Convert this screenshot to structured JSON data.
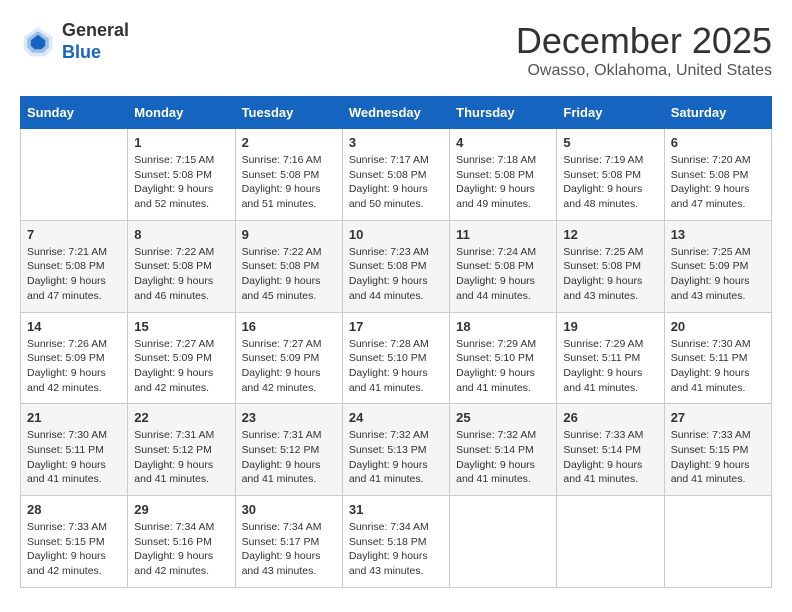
{
  "logo": {
    "general": "General",
    "blue": "Blue"
  },
  "header": {
    "month": "December 2025",
    "location": "Owasso, Oklahoma, United States"
  },
  "weekdays": [
    "Sunday",
    "Monday",
    "Tuesday",
    "Wednesday",
    "Thursday",
    "Friday",
    "Saturday"
  ],
  "weeks": [
    [
      {
        "day": "",
        "info": ""
      },
      {
        "day": "1",
        "info": "Sunrise: 7:15 AM\nSunset: 5:08 PM\nDaylight: 9 hours\nand 52 minutes."
      },
      {
        "day": "2",
        "info": "Sunrise: 7:16 AM\nSunset: 5:08 PM\nDaylight: 9 hours\nand 51 minutes."
      },
      {
        "day": "3",
        "info": "Sunrise: 7:17 AM\nSunset: 5:08 PM\nDaylight: 9 hours\nand 50 minutes."
      },
      {
        "day": "4",
        "info": "Sunrise: 7:18 AM\nSunset: 5:08 PM\nDaylight: 9 hours\nand 49 minutes."
      },
      {
        "day": "5",
        "info": "Sunrise: 7:19 AM\nSunset: 5:08 PM\nDaylight: 9 hours\nand 48 minutes."
      },
      {
        "day": "6",
        "info": "Sunrise: 7:20 AM\nSunset: 5:08 PM\nDaylight: 9 hours\nand 47 minutes."
      }
    ],
    [
      {
        "day": "7",
        "info": "Sunrise: 7:21 AM\nSunset: 5:08 PM\nDaylight: 9 hours\nand 47 minutes."
      },
      {
        "day": "8",
        "info": "Sunrise: 7:22 AM\nSunset: 5:08 PM\nDaylight: 9 hours\nand 46 minutes."
      },
      {
        "day": "9",
        "info": "Sunrise: 7:22 AM\nSunset: 5:08 PM\nDaylight: 9 hours\nand 45 minutes."
      },
      {
        "day": "10",
        "info": "Sunrise: 7:23 AM\nSunset: 5:08 PM\nDaylight: 9 hours\nand 44 minutes."
      },
      {
        "day": "11",
        "info": "Sunrise: 7:24 AM\nSunset: 5:08 PM\nDaylight: 9 hours\nand 44 minutes."
      },
      {
        "day": "12",
        "info": "Sunrise: 7:25 AM\nSunset: 5:08 PM\nDaylight: 9 hours\nand 43 minutes."
      },
      {
        "day": "13",
        "info": "Sunrise: 7:25 AM\nSunset: 5:09 PM\nDaylight: 9 hours\nand 43 minutes."
      }
    ],
    [
      {
        "day": "14",
        "info": "Sunrise: 7:26 AM\nSunset: 5:09 PM\nDaylight: 9 hours\nand 42 minutes."
      },
      {
        "day": "15",
        "info": "Sunrise: 7:27 AM\nSunset: 5:09 PM\nDaylight: 9 hours\nand 42 minutes."
      },
      {
        "day": "16",
        "info": "Sunrise: 7:27 AM\nSunset: 5:09 PM\nDaylight: 9 hours\nand 42 minutes."
      },
      {
        "day": "17",
        "info": "Sunrise: 7:28 AM\nSunset: 5:10 PM\nDaylight: 9 hours\nand 41 minutes."
      },
      {
        "day": "18",
        "info": "Sunrise: 7:29 AM\nSunset: 5:10 PM\nDaylight: 9 hours\nand 41 minutes."
      },
      {
        "day": "19",
        "info": "Sunrise: 7:29 AM\nSunset: 5:11 PM\nDaylight: 9 hours\nand 41 minutes."
      },
      {
        "day": "20",
        "info": "Sunrise: 7:30 AM\nSunset: 5:11 PM\nDaylight: 9 hours\nand 41 minutes."
      }
    ],
    [
      {
        "day": "21",
        "info": "Sunrise: 7:30 AM\nSunset: 5:11 PM\nDaylight: 9 hours\nand 41 minutes."
      },
      {
        "day": "22",
        "info": "Sunrise: 7:31 AM\nSunset: 5:12 PM\nDaylight: 9 hours\nand 41 minutes."
      },
      {
        "day": "23",
        "info": "Sunrise: 7:31 AM\nSunset: 5:12 PM\nDaylight: 9 hours\nand 41 minutes."
      },
      {
        "day": "24",
        "info": "Sunrise: 7:32 AM\nSunset: 5:13 PM\nDaylight: 9 hours\nand 41 minutes."
      },
      {
        "day": "25",
        "info": "Sunrise: 7:32 AM\nSunset: 5:14 PM\nDaylight: 9 hours\nand 41 minutes."
      },
      {
        "day": "26",
        "info": "Sunrise: 7:33 AM\nSunset: 5:14 PM\nDaylight: 9 hours\nand 41 minutes."
      },
      {
        "day": "27",
        "info": "Sunrise: 7:33 AM\nSunset: 5:15 PM\nDaylight: 9 hours\nand 41 minutes."
      }
    ],
    [
      {
        "day": "28",
        "info": "Sunrise: 7:33 AM\nSunset: 5:15 PM\nDaylight: 9 hours\nand 42 minutes."
      },
      {
        "day": "29",
        "info": "Sunrise: 7:34 AM\nSunset: 5:16 PM\nDaylight: 9 hours\nand 42 minutes."
      },
      {
        "day": "30",
        "info": "Sunrise: 7:34 AM\nSunset: 5:17 PM\nDaylight: 9 hours\nand 43 minutes."
      },
      {
        "day": "31",
        "info": "Sunrise: 7:34 AM\nSunset: 5:18 PM\nDaylight: 9 hours\nand 43 minutes."
      },
      {
        "day": "",
        "info": ""
      },
      {
        "day": "",
        "info": ""
      },
      {
        "day": "",
        "info": ""
      }
    ]
  ]
}
